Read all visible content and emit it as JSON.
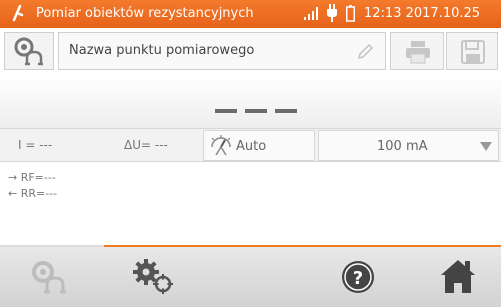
{
  "status_bar": {
    "title": "Pomiar obiektów rezystancyjnych",
    "datetime": "12:13 2017.10.25",
    "bar_color": "#f07b22",
    "icons": [
      "meter-icon",
      "signal-icon",
      "plug-icon",
      "battery-icon"
    ]
  },
  "header": {
    "point_name_placeholder": "Nazwa punktu pomiarowego",
    "icons": [
      "probe-icon",
      "pencil-icon",
      "printer-icon",
      "save-icon"
    ]
  },
  "result": {
    "main_value": "- - -"
  },
  "params": {
    "current": "I = ---",
    "voltage_drop": "ΔU= ---",
    "auto_label": "Auto",
    "test_current": "100 mA"
  },
  "details": {
    "rf": "→ RF=---",
    "rr": "← RR=---"
  },
  "bottom_bar": {
    "icons": [
      "probe-icon",
      "settings-icon",
      "help-icon",
      "home-icon"
    ]
  }
}
